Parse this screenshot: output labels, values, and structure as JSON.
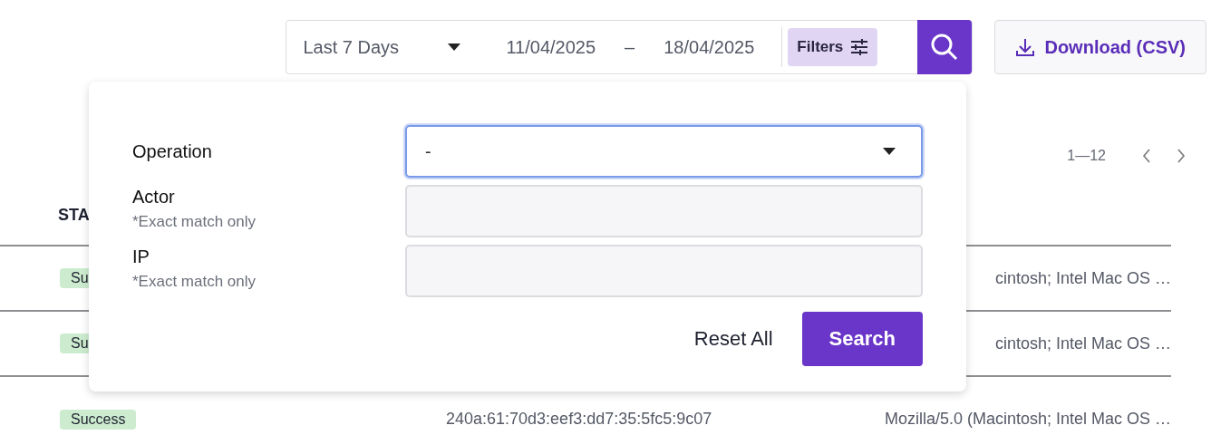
{
  "toolbar": {
    "range": "Last 7 Days",
    "date_from": "11/04/2025",
    "separator": "–",
    "date_to": "18/04/2025",
    "filters_button": "Filters",
    "download_button": "Download (CSV)"
  },
  "pagination": {
    "range": "1—12"
  },
  "table": {
    "columns": [
      "STA"
    ],
    "rows": [
      {
        "status": "Su",
        "ip": "",
        "agent": "cintosh; Intel Mac OS …"
      },
      {
        "status": "Su",
        "ip": "",
        "agent": "cintosh; Intel Mac OS …"
      },
      {
        "status": "Success",
        "ip": "240a:61:70d3:eef3:dd7:35:5fc5:9c07",
        "agent": "Mozilla/5.0 (Macintosh; Intel Mac OS …"
      }
    ]
  },
  "filters_popup": {
    "fields": [
      {
        "kind": "select",
        "label": "Operation",
        "value": "-",
        "focused": true
      },
      {
        "kind": "text",
        "label": "Actor",
        "hint": "*Exact match only",
        "focused": false
      },
      {
        "kind": "text",
        "label": "IP",
        "hint": "*Exact match only",
        "focused": false
      }
    ],
    "reset_button": "Reset All",
    "search_button": "Search"
  }
}
